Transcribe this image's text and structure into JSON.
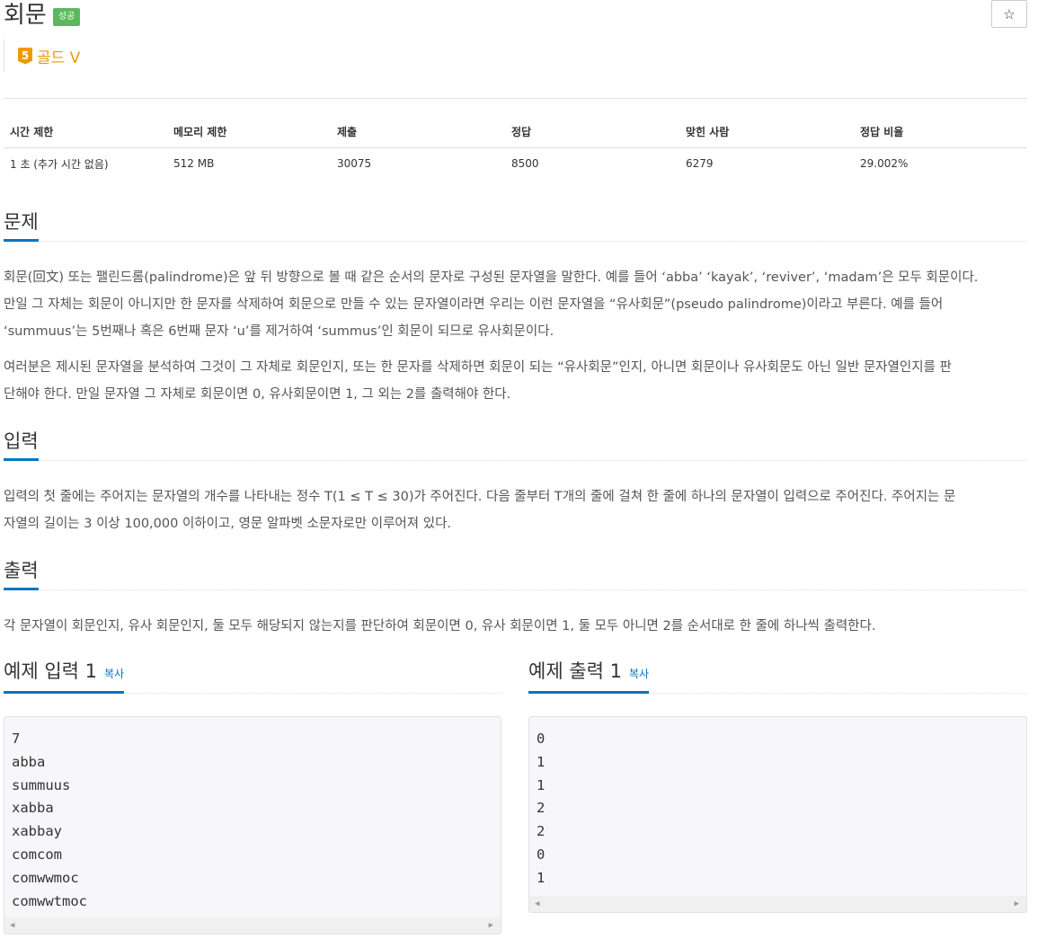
{
  "problem": {
    "title": "회문",
    "status_badge": "성공",
    "star_icon": "☆",
    "tier_number": "5",
    "tier_label": "골드 V"
  },
  "info_table": {
    "headers": [
      "시간 제한",
      "메모리 제한",
      "제출",
      "정답",
      "맞힌 사람",
      "정답 비율"
    ],
    "values": [
      "1 초 (추가 시간 없음)",
      "512 MB",
      "30075",
      "8500",
      "6279",
      "29.002%"
    ]
  },
  "sections": {
    "problem": {
      "heading": "문제",
      "para1_line1": "회문(回文) 또는 팰린드롬(palindrome)은 앞 뒤 방향으로 볼 때 같은 순서의 문자로 구성된 문자열을 말한다. 예를 들어 ‘abba’ ‘kayak’, ‘reviver’, ‘madam’은 모두 회문이다.",
      "para1_line2": "만일 그 자체는 회문이 아니지만 한 문자를 삭제하여 회문으로 만들 수 있는 문자열이라면 우리는 이런 문자열을 “유사회문”(pseudo palindrome)이라고 부른다. 예를 들어",
      "para1_line3": "‘summuus’는 5번째나 혹은 6번째 문자 ‘u’를 제거하여 ‘summus’인 회문이 되므로 유사회문이다.",
      "para2_line1": "여러분은 제시된 문자열을 분석하여 그것이 그 자체로 회문인지, 또는 한 문자를 삭제하면 회문이 되는 “유사회문”인지, 아니면 회문이나 유사회문도 아닌 일반 문자열인지를 판",
      "para2_line2": "단해야 한다. 만일 문자열 그 자체로 회문이면 0, 유사회문이면 1, 그 외는 2를 출력해야 한다."
    },
    "input": {
      "heading": "입력",
      "line1": "입력의 첫 줄에는 주어지는 문자열의 개수를 나타내는 정수 T(1 ≤ T ≤ 30)가 주어진다. 다음 줄부터 T개의 줄에 걸쳐 한 줄에 하나의 문자열이 입력으로 주어진다. 주어지는 문",
      "line2": "자열의 길이는 3 이상 100,000 이하이고, 영문 알파벳 소문자로만 이루어져 있다."
    },
    "output": {
      "heading": "출력",
      "line1": "각 문자열이 회문인지, 유사 회문인지, 둘 모두 해당되지 않는지를 판단하여 회문이면 0, 유사 회문이면 1, 둘 모두 아니면 2를 순서대로 한 줄에 하나씩 출력한다."
    },
    "sample_input": {
      "heading": "예제 입력 1",
      "copy_label": "복사",
      "content": "7\nabba\nsummuus\nxabba\nxabbay\ncomcom\ncomwwmoc\ncomwwtmoc"
    },
    "sample_output": {
      "heading": "예제 출력 1",
      "copy_label": "복사",
      "content": "0\n1\n1\n2\n2\n0\n1"
    }
  }
}
